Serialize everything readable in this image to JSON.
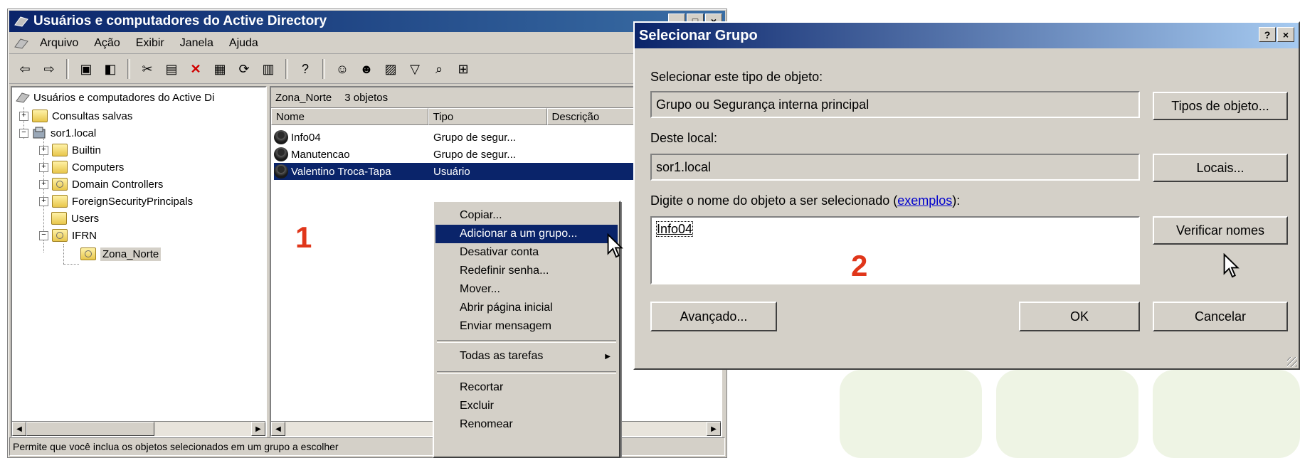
{
  "mmc": {
    "title": "Usuários e computadores do Active Directory",
    "menu": [
      "Arquivo",
      "Ação",
      "Exibir",
      "Janela",
      "Ajuda"
    ],
    "tree": {
      "root": "Usuários e computadores do Active Di",
      "saved_queries": "Consultas salvas",
      "domain": "sor1.local",
      "builtin": "Builtin",
      "computers": "Computers",
      "domain_controllers": "Domain Controllers",
      "fsp": "ForeignSecurityPrincipals",
      "users": "Users",
      "ifrn": "IFRN",
      "zona_norte": "Zona_Norte"
    },
    "list": {
      "location": "Zona_Norte",
      "count": "3 objetos",
      "columns": [
        "Nome",
        "Tipo",
        "Descrição"
      ],
      "rows": [
        {
          "name": "Info04",
          "type": "Grupo de segur..."
        },
        {
          "name": "Manutencao",
          "type": "Grupo de segur..."
        },
        {
          "name": "Valentino Troca-Tapa",
          "type": "Usuário"
        }
      ]
    },
    "status": "Permite que você inclua os objetos selecionados em um grupo a escolher"
  },
  "context_menu": {
    "items": [
      "Copiar...",
      "Adicionar a um grupo...",
      "Desativar conta",
      "Redefinir senha...",
      "Mover...",
      "Abrir página inicial",
      "Enviar mensagem"
    ],
    "all_tasks": "Todas as tarefas",
    "bottom_items": [
      "Recortar",
      "Excluir",
      "Renomear"
    ]
  },
  "dialog": {
    "title": "Selecionar Grupo",
    "object_type_label": "Selecionar este tipo de objeto:",
    "object_type_value": "Grupo ou Segurança interna principal",
    "object_types_button": "Tipos de objeto...",
    "location_label": "Deste local:",
    "location_value": "sor1.local",
    "locations_button": "Locais...",
    "name_label": "Digite o nome do objeto a ser selecionado (",
    "examples_link": "exemplos",
    "name_label_end": "):",
    "name_value": "Info04",
    "check_names_button": "Verificar nomes",
    "advanced_button": "Avançado...",
    "ok_button": "OK",
    "cancel_button": "Cancelar"
  },
  "steps": {
    "one": "1",
    "two": "2"
  },
  "colors": {
    "titlebar": "#0a246a",
    "step": "#e0361a",
    "selection": "#0a246a",
    "face": "#d4d0c8"
  }
}
